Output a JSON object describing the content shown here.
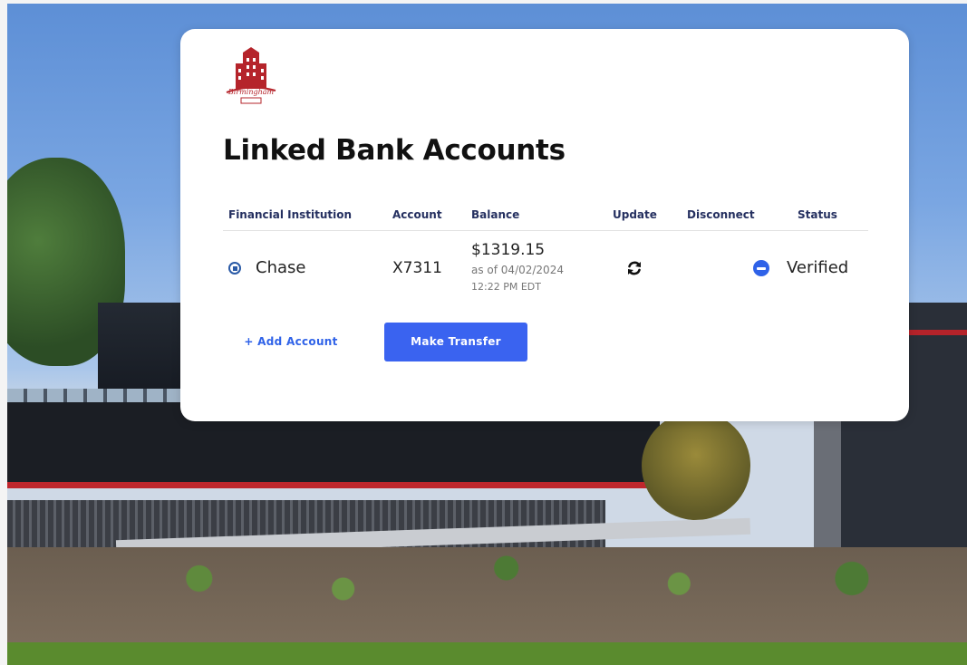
{
  "page": {
    "title": "Linked Bank Accounts",
    "logo_text": "Birmingham"
  },
  "table": {
    "headers": {
      "institution": "Financial Institution",
      "account": "Account",
      "balance": "Balance",
      "update": "Update",
      "disconnect": "Disconnect",
      "status": "Status"
    },
    "rows": [
      {
        "institution": "Chase",
        "account": "X7311",
        "balance": "$1319.15",
        "balance_date": "as of 04/02/2024",
        "balance_time": "12:22 PM EDT",
        "status": "Verified"
      }
    ]
  },
  "actions": {
    "add_account": "+ Add Account",
    "make_transfer": "Make Transfer"
  },
  "colors": {
    "accent": "#3a63f0",
    "header_text": "#253060",
    "logo": "#b5242b"
  },
  "icons": {
    "update": "refresh-icon",
    "disconnect": "minus-circle-icon",
    "institution": "chase-logo-icon"
  }
}
